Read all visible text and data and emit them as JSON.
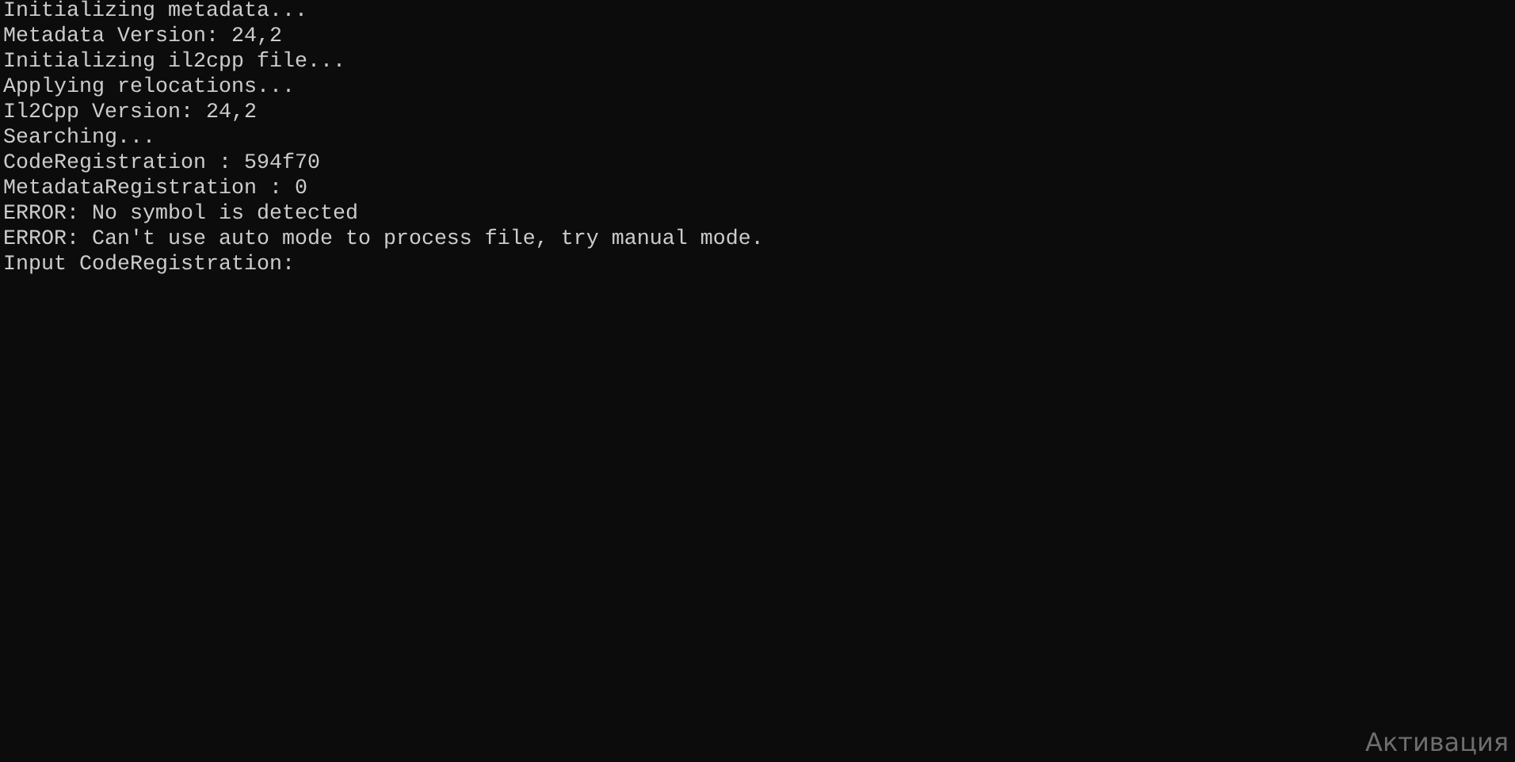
{
  "console": {
    "lines": [
      "Initializing metadata...",
      "Metadata Version: 24,2",
      "Initializing il2cpp file...",
      "Applying relocations...",
      "Il2Cpp Version: 24,2",
      "Searching...",
      "CodeRegistration : 594f70",
      "MetadataRegistration : 0",
      "ERROR: No symbol is detected",
      "ERROR: Can't use auto mode to process file, try manual mode.",
      "Input CodeRegistration:"
    ]
  },
  "activation_notice": "Активация"
}
